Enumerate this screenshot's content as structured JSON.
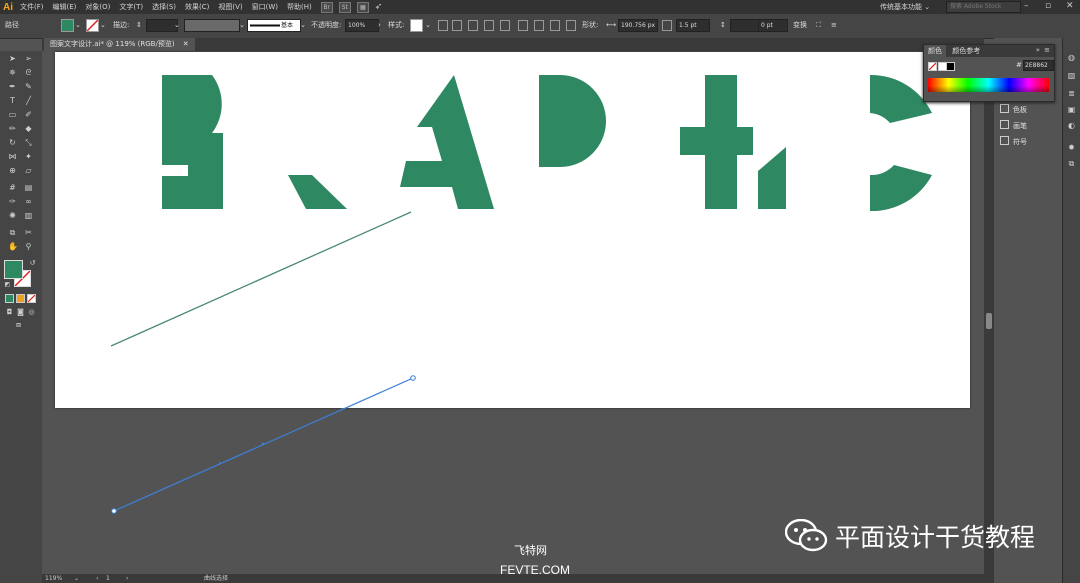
{
  "app": {
    "logo": "Ai"
  },
  "menubar": {
    "items": [
      "文件(F)",
      "编辑(E)",
      "对象(O)",
      "文字(T)",
      "选择(S)",
      "效果(C)",
      "视图(V)",
      "窗口(W)",
      "帮助(H)"
    ],
    "bridge": "Br",
    "stock": "St",
    "workspace": "传统基本功能",
    "search_placeholder": "搜索 Adobe Stock"
  },
  "controlbar": {
    "selection_label": "路径",
    "fill_color": "#2e8862",
    "stroke_label": "描边:",
    "brush_label": "基本",
    "opacity_label": "不透明度:",
    "opacity_value": "100%",
    "style_label": "样式:",
    "shape_label": "形状:",
    "shape_width": "190.756 px",
    "shape_height": "1.5 pt",
    "angle_value": "0 pt",
    "transform_label": "变换"
  },
  "document": {
    "tab_title": "图案文字设计.ai* @ 119% (RGB/预览)"
  },
  "artwork": {
    "word": "GRAPHIC",
    "color": "#2e8862",
    "line_color": "#4a8a6e",
    "path_color": "#3e7fd8"
  },
  "color_panel": {
    "tabs": [
      "颜色",
      "颜色参考"
    ],
    "hex_label": "#",
    "hex_value": "2E8862"
  },
  "dock": {
    "items": [
      "色板",
      "画笔",
      "符号"
    ]
  },
  "statusbar": {
    "zoom": "119%",
    "page": "1",
    "mode": "曲线选择"
  },
  "watermark": {
    "text": "平面设计干货教程",
    "site_cn": "飞特网",
    "site_en": "FEVTE.COM"
  }
}
